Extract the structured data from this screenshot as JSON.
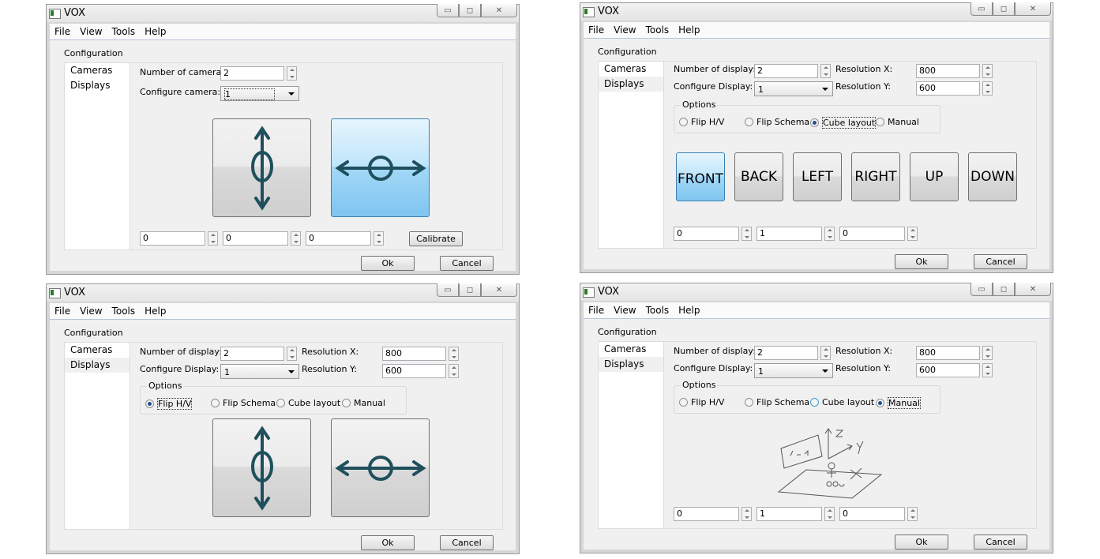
{
  "windows": [
    {
      "title": "VOX",
      "menu": [
        "File",
        "View",
        "Tools",
        "Help"
      ],
      "group_label": "Configuration",
      "sidebar": [
        "Cameras",
        "Displays"
      ],
      "selected_sidebar": "Cameras",
      "count_label": "Number of cameras:",
      "count_value": "2",
      "config_label": "Configure camera:",
      "config_value": "1",
      "spin_values": [
        "0",
        "0",
        "0"
      ],
      "calibrate_label": "Calibrate",
      "ok_label": "Ok",
      "cancel_label": "Cancel",
      "pressed_button": "horizontal"
    },
    {
      "title": "VOX",
      "menu": [
        "File",
        "View",
        "Tools",
        "Help"
      ],
      "group_label": "Configuration",
      "sidebar": [
        "Cameras",
        "Displays"
      ],
      "selected_sidebar": "Displays",
      "count_label": "Number of displays:",
      "count_value": "2",
      "config_label": "Configure Display:",
      "config_value": "1",
      "resx_label": "Resolution X:",
      "resx_value": "800",
      "resy_label": "Resolution Y:",
      "resy_value": "600",
      "options_label": "Options",
      "options": [
        "Flip H/V",
        "Flip Schema",
        "Cube layout",
        "Manual"
      ],
      "selected_option": "Cube layout",
      "faces": [
        "FRONT",
        "BACK",
        "LEFT",
        "RIGHT",
        "UP",
        "DOWN"
      ],
      "active_face": "FRONT",
      "spin_values": [
        "0",
        "1",
        "0"
      ],
      "ok_label": "Ok",
      "cancel_label": "Cancel"
    },
    {
      "title": "VOX",
      "menu": [
        "File",
        "View",
        "Tools",
        "Help"
      ],
      "group_label": "Configuration",
      "sidebar": [
        "Cameras",
        "Displays"
      ],
      "selected_sidebar": "Displays",
      "count_label": "Number of displays:",
      "count_value": "2",
      "config_label": "Configure Display:",
      "config_value": "1",
      "resx_label": "Resolution X:",
      "resx_value": "800",
      "resy_label": "Resolution Y:",
      "resy_value": "600",
      "options_label": "Options",
      "options": [
        "Flip H/V",
        "Flip Schema",
        "Cube layout",
        "Manual"
      ],
      "selected_option": "Flip H/V",
      "ok_label": "Ok",
      "cancel_label": "Cancel"
    },
    {
      "title": "VOX",
      "menu": [
        "File",
        "View",
        "Tools",
        "Help"
      ],
      "group_label": "Configuration",
      "sidebar": [
        "Cameras",
        "Displays"
      ],
      "selected_sidebar": "Displays",
      "count_label": "Number of displays:",
      "count_value": "2",
      "config_label": "Configure Display:",
      "config_value": "1",
      "resx_label": "Resolution X:",
      "resx_value": "800",
      "resy_label": "Resolution Y:",
      "resy_value": "600",
      "options_label": "Options",
      "options": [
        "Flip H/V",
        "Flip Schema",
        "Cube layout",
        "Manual"
      ],
      "selected_option": "Manual",
      "spin_values": [
        "0",
        "1",
        "0"
      ],
      "ok_label": "Ok",
      "cancel_label": "Cancel"
    }
  ],
  "icons": {
    "arrow_color": "#1f4f5c",
    "active_blue": "#7ec5f0"
  }
}
